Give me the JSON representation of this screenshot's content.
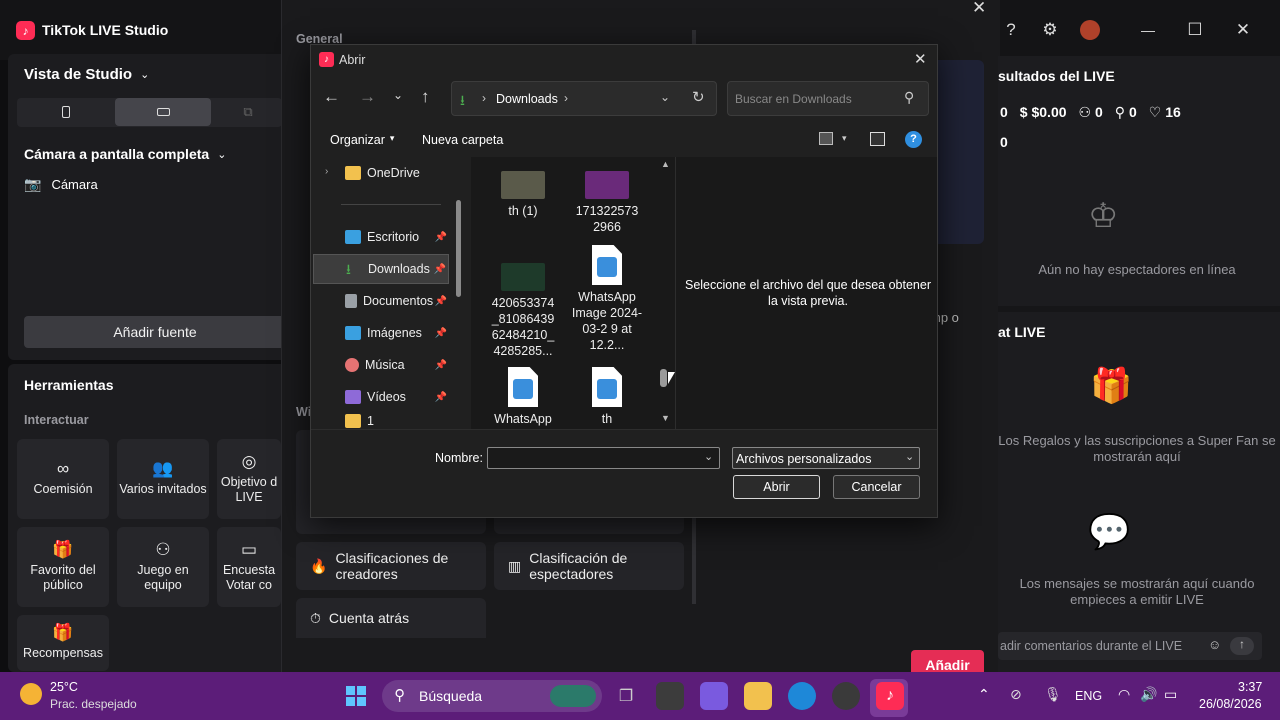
{
  "app": {
    "title": "TikTok LIVE Studio",
    "logo_glyph": "♪"
  },
  "titlebar": {
    "help_icon": "?",
    "settings_icon": "⚙"
  },
  "left": {
    "view_label": "Vista de Studio",
    "scene_label": "Cámara a pantalla completa",
    "camera_label": "Cámara",
    "add_source": "Añadir fuente",
    "tools_title": "Herramientas",
    "interact_label": "Interactuar",
    "tools": [
      {
        "label": "Coemisión",
        "icon": "∞"
      },
      {
        "label": "Varios invitados",
        "icon": "👥"
      },
      {
        "label": "Objetivo d LIVE",
        "icon": "◎"
      },
      {
        "label": "Favorito del público",
        "icon": "🎁"
      },
      {
        "label": "Juego en equipo",
        "icon": "⚇"
      },
      {
        "label": "Encuesta Votar co",
        "icon": "▭"
      },
      {
        "label": "Recompensas",
        "icon": "🎁"
      }
    ]
  },
  "modal": {
    "general_label": "General",
    "partial_w": "Wi",
    "partial_text": "mp o",
    "cards": [
      {
        "label": "Clasificaciones de creadores",
        "icon": "🔥"
      },
      {
        "label": "Clasificación de espectadores",
        "icon": "▥"
      },
      {
        "label": "Cuenta atrás",
        "icon": "⏱"
      }
    ],
    "add_button": "Añadir",
    "close_icon": "✕"
  },
  "right": {
    "results_title": "sultados del LIVE",
    "stats": [
      "0",
      "$0.00",
      "0",
      "0",
      "16"
    ],
    "stat_second_row": "0",
    "no_viewers": "Aún no hay espectadores en línea",
    "chat_title": "at LIVE",
    "gifts_text": "Los Regalos y las suscripciones a Super Fan se mostrarán aquí",
    "messages_text": "Los mensajes se mostrarán aquí cuando empieces a emitir LIVE",
    "comment_placeholder": "adir comentarios durante el LIVE"
  },
  "dialog": {
    "title": "Abrir",
    "path": "Downloads",
    "search_placeholder": "Buscar en Downloads",
    "organize": "Organizar",
    "new_folder": "Nueva carpeta",
    "nav_items": [
      {
        "label": "OneDrive",
        "color": "#f2c14e",
        "pinned": false
      },
      {
        "label": "Escritorio",
        "color": "#3aa0e0",
        "pinned": true
      },
      {
        "label": "Downloads",
        "color": "#4caf50",
        "pinned": true
      },
      {
        "label": "Documentos",
        "color": "#9aa0a6",
        "pinned": true
      },
      {
        "label": "Imágenes",
        "color": "#3aa0e0",
        "pinned": true
      },
      {
        "label": "Música",
        "color": "#e57373",
        "pinned": true
      },
      {
        "label": "Vídeos",
        "color": "#8e6ad8",
        "pinned": true
      },
      {
        "label": "1",
        "color": "#f2c14e",
        "pinned": false
      }
    ],
    "files": [
      {
        "name": "th (1)",
        "kind": "photo",
        "color": "#5a5a4a"
      },
      {
        "name": "171322573 2966",
        "kind": "photo",
        "color": "#6a2a7a"
      },
      {
        "name": "420653374 _81086439 62484210_ 4285285...",
        "kind": "photo",
        "color": "#1e3a2a"
      },
      {
        "name": "WhatsApp Image 2024-03-2 9 at 12.2...",
        "kind": "image"
      },
      {
        "name": "WhatsApp",
        "kind": "image"
      },
      {
        "name": "th",
        "kind": "image"
      }
    ],
    "preview_text": "Seleccione el archivo del que desea obtener la vista previa.",
    "name_label": "Nombre:",
    "name_value": "",
    "filter": "Archivos personalizados",
    "open_button": "Abrir",
    "cancel_button": "Cancelar"
  },
  "taskbar": {
    "temp": "25°C",
    "weather": "Prac. despejado",
    "search": "Búsqueda",
    "lang": "ENG",
    "time": "3:37",
    "date": "26/08/2026"
  }
}
